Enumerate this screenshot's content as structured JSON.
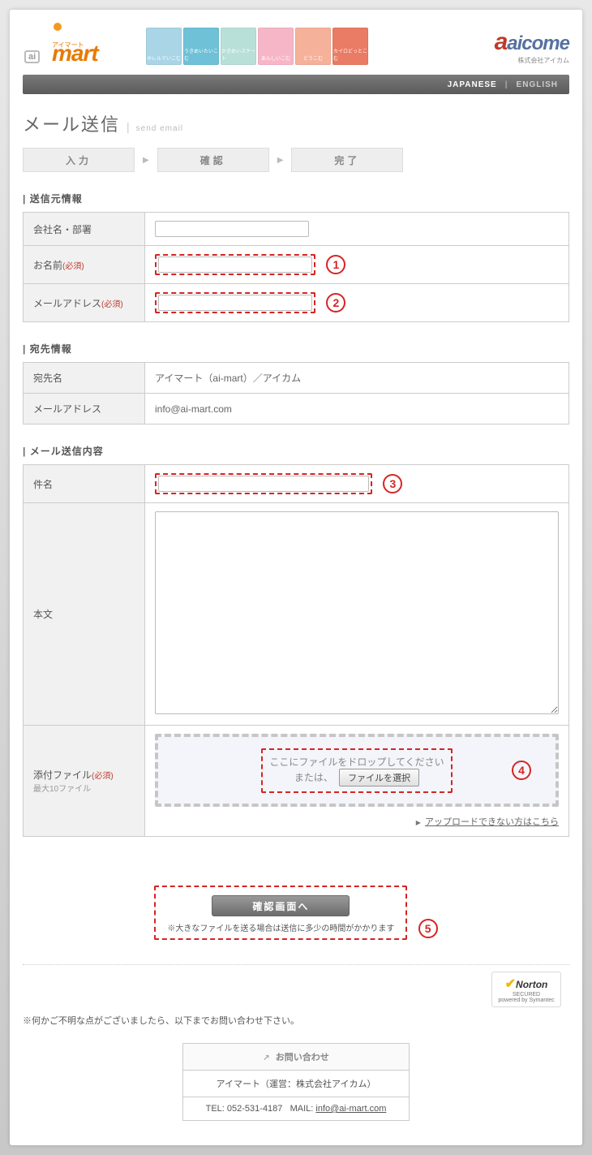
{
  "header": {
    "logo_text": "mart",
    "logo_sub": "アイマート",
    "categories": [
      "ホレルでいこむ",
      "うきめいたいこむ",
      "かきめいスケート",
      "あんしいこむ",
      "どうこむ",
      "カイロどっとこむ"
    ],
    "aicome_big": "aicome",
    "aicome_sub": "株式会社アイカム",
    "lang_jp": "JAPANESE",
    "lang_en": "ENGLISH"
  },
  "title": {
    "jp": "メール送信",
    "en": "send email"
  },
  "steps": {
    "s1": "入力",
    "s2": "確認",
    "s3": "完了"
  },
  "annot": {
    "n1": "1",
    "n2": "2",
    "n3": "3",
    "n4": "4",
    "n5": "5"
  },
  "sect1": {
    "head": "送信元情報",
    "row1_label": "会社名・部署",
    "row2_label": "お名前",
    "row3_label": "メールアドレス",
    "required": "(必須)"
  },
  "sect2": {
    "head": "宛先情報",
    "row1_label": "宛先名",
    "row1_value": "アイマート（ai-mart）／アイカム",
    "row2_label": "メールアドレス",
    "row2_value": "info@ai-mart.com"
  },
  "sect3": {
    "head": "メール送信内容",
    "subject_label": "件名",
    "body_label": "本文",
    "attach_label": "添付ファイル",
    "attach_sub": "最大10ファイル",
    "drop_text": "ここにファイルをドロップしてください",
    "drop_or": "または、",
    "file_btn": "ファイルを選択",
    "upload_link": "アップロードできない方はこちら"
  },
  "submit": {
    "button": "確認画面へ",
    "note": "※大きなファイルを送る場合は送信に多少の時間がかかります"
  },
  "footer": {
    "note": "※何かご不明な点がございましたら、以下までお問い合わせ下さい。",
    "norton_word": "Norton",
    "norton_sub1": "SECURED",
    "norton_sub2": "powered by Symantec",
    "contact_head": "お問い合わせ",
    "contact_line1": "アイマート（運営：株式会社アイカム）",
    "contact_tel": "TEL: 052-531-4187",
    "contact_mail_label": "MAIL:",
    "contact_mail": "info@ai-mart.com"
  }
}
